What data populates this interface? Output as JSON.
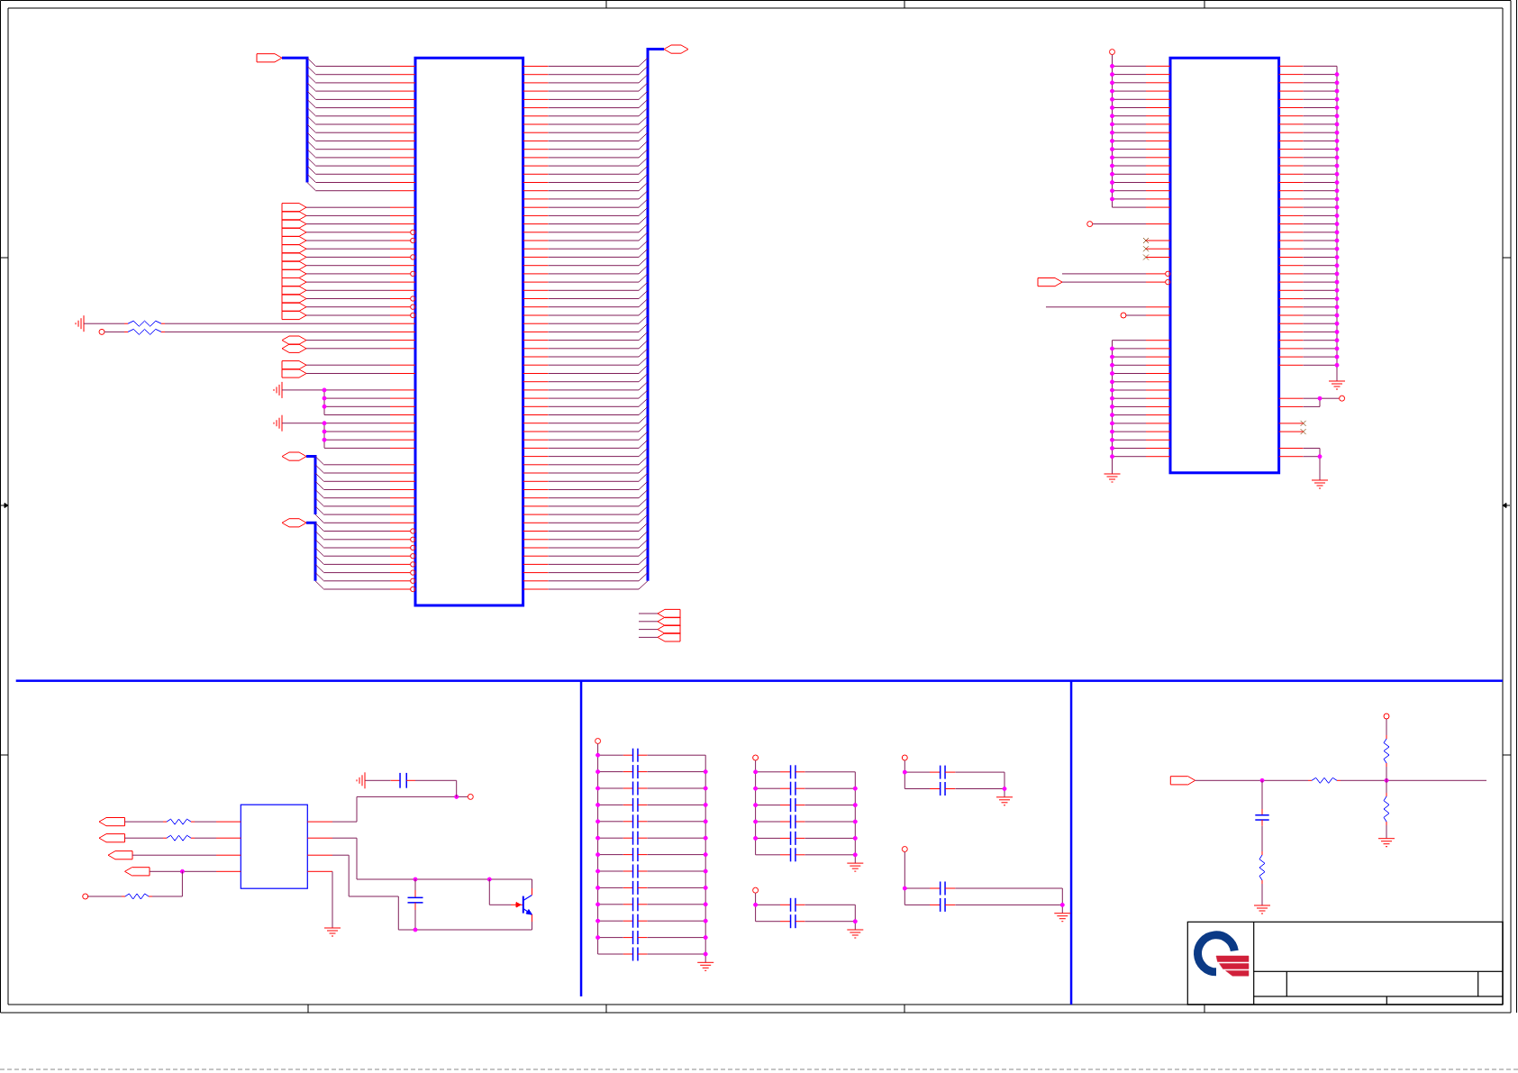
{
  "connector": {
    "left_groups": [
      {
        "kind": "bus",
        "port": {
          "kind": "output"
        },
        "pins": [
          {
            "inverted": false
          },
          {
            "inverted": false
          },
          {
            "inverted": false
          },
          {
            "inverted": false
          },
          {
            "inverted": false
          },
          {
            "inverted": false
          },
          {
            "inverted": false
          },
          {
            "inverted": false
          },
          {
            "inverted": false
          },
          {
            "inverted": false
          },
          {
            "inverted": false
          },
          {
            "inverted": false
          },
          {
            "inverted": false
          },
          {
            "inverted": false
          },
          {
            "inverted": false
          },
          {
            "inverted": false
          }
        ]
      },
      {
        "kind": "input-ports",
        "pins": [
          {
            "inverted": false
          },
          {
            "inverted": false
          },
          {
            "inverted": false
          },
          {
            "inverted": true
          },
          {
            "inverted": true
          },
          {
            "inverted": false
          },
          {
            "inverted": true
          },
          {
            "inverted": false
          },
          {
            "inverted": true
          },
          {
            "inverted": false
          },
          {
            "inverted": false
          },
          {
            "inverted": true
          },
          {
            "inverted": true
          },
          {
            "inverted": true
          }
        ]
      },
      {
        "kind": "resistor-to-ground",
        "pins": [
          {
            "inverted": false
          }
        ]
      },
      {
        "kind": "resistor-to-terminal",
        "pins": [
          {
            "inverted": false
          }
        ]
      },
      {
        "kind": "bidir-ports",
        "pins": [
          {
            "inverted": false
          },
          {
            "inverted": false
          }
        ]
      },
      {
        "kind": "input-ports",
        "pins": [
          {
            "inverted": false
          },
          {
            "inverted": false
          }
        ]
      },
      {
        "kind": "chassis-ground-tie",
        "pins": [
          {
            "inverted": false
          },
          {
            "inverted": false
          },
          {
            "inverted": false
          },
          {
            "inverted": false
          }
        ]
      },
      {
        "kind": "chassis-ground-tie",
        "pins": [
          {
            "inverted": false
          },
          {
            "inverted": false
          },
          {
            "inverted": false
          },
          {
            "inverted": false
          }
        ]
      },
      {
        "kind": "bus",
        "port": {
          "kind": "bidir"
        },
        "pins": [
          {
            "inverted": false
          },
          {
            "inverted": false
          },
          {
            "inverted": false
          },
          {
            "inverted": false
          },
          {
            "inverted": false
          },
          {
            "inverted": false
          },
          {
            "inverted": false
          },
          {
            "inverted": false
          }
        ]
      },
      {
        "kind": "bus",
        "port": {
          "kind": "bidir"
        },
        "pins": [
          {
            "inverted": true
          },
          {
            "inverted": true
          },
          {
            "inverted": true
          },
          {
            "inverted": true
          },
          {
            "inverted": true
          },
          {
            "inverted": true
          },
          {
            "inverted": true
          },
          {
            "inverted": true
          }
        ]
      }
    ],
    "right_groups": [
      {
        "kind": "bus",
        "port": {
          "kind": "bidir"
        },
        "pins": [
          {
            "inverted": false
          },
          {
            "inverted": false
          },
          {
            "inverted": false
          },
          {
            "inverted": false
          },
          {
            "inverted": false
          },
          {
            "inverted": false
          },
          {
            "inverted": false
          },
          {
            "inverted": false
          },
          {
            "inverted": false
          },
          {
            "inverted": false
          },
          {
            "inverted": false
          },
          {
            "inverted": false
          },
          {
            "inverted": false
          },
          {
            "inverted": false
          },
          {
            "inverted": false
          },
          {
            "inverted": false
          },
          {
            "inverted": false
          },
          {
            "inverted": false
          },
          {
            "inverted": false
          },
          {
            "inverted": false
          },
          {
            "inverted": false
          },
          {
            "inverted": false
          },
          {
            "inverted": false
          },
          {
            "inverted": false
          },
          {
            "inverted": false
          },
          {
            "inverted": false
          },
          {
            "inverted": false
          },
          {
            "inverted": false
          },
          {
            "inverted": false
          },
          {
            "inverted": false
          },
          {
            "inverted": false
          },
          {
            "inverted": false
          },
          {
            "inverted": false
          },
          {
            "inverted": false
          },
          {
            "inverted": false
          },
          {
            "inverted": false
          },
          {
            "inverted": false
          },
          {
            "inverted": false
          },
          {
            "inverted": false
          },
          {
            "inverted": false
          },
          {
            "inverted": false
          },
          {
            "inverted": false
          },
          {
            "inverted": false
          },
          {
            "inverted": false
          },
          {
            "inverted": false
          },
          {
            "inverted": false
          },
          {
            "inverted": false
          },
          {
            "inverted": false
          },
          {
            "inverted": false
          },
          {
            "inverted": false
          },
          {
            "inverted": false
          },
          {
            "inverted": false
          },
          {
            "inverted": false
          },
          {
            "inverted": false
          },
          {
            "inverted": false
          },
          {
            "inverted": false
          },
          {
            "inverted": false
          },
          {
            "inverted": false
          },
          {
            "inverted": false
          },
          {
            "inverted": false
          },
          {
            "inverted": false
          },
          {
            "inverted": false
          },
          {
            "inverted": false
          },
          {
            "inverted": false
          }
        ]
      }
    ],
    "spare_ports": [
      {
        "kind": "output-port"
      },
      {
        "kind": "output-port"
      },
      {
        "kind": "output-port"
      },
      {
        "kind": "output-port"
      }
    ]
  },
  "memory": {
    "left_groups": [
      {
        "kind": "supply-tie",
        "pins": [
          {
            "inverted": false
          },
          {
            "inverted": false
          },
          {
            "inverted": false
          },
          {
            "inverted": false
          },
          {
            "inverted": false
          },
          {
            "inverted": false
          },
          {
            "inverted": false
          },
          {
            "inverted": false
          },
          {
            "inverted": false
          },
          {
            "inverted": false
          },
          {
            "inverted": false
          },
          {
            "inverted": false
          },
          {
            "inverted": false
          },
          {
            "inverted": false
          },
          {
            "inverted": false
          },
          {
            "inverted": false
          },
          {
            "inverted": false
          },
          {
            "inverted": false
          }
        ]
      },
      {
        "kind": "terminal",
        "pins": [
          {
            "inverted": false
          }
        ]
      },
      {
        "kind": "no-connect",
        "pins": [
          {
            "inverted": false
          },
          {
            "inverted": false
          },
          {
            "inverted": false
          }
        ]
      },
      {
        "kind": "open-wire",
        "pins": [
          {
            "inverted": true
          }
        ]
      },
      {
        "kind": "input-ports",
        "pins": [
          {
            "inverted": true
          }
        ]
      },
      {
        "kind": "open-wire",
        "pins": [
          {
            "inverted": false
          }
        ]
      },
      {
        "kind": "terminal",
        "pins": [
          {
            "inverted": false
          }
        ]
      },
      {
        "kind": "ground-tie",
        "pins": [
          {
            "inverted": false
          },
          {
            "inverted": false
          },
          {
            "inverted": false
          },
          {
            "inverted": false
          },
          {
            "inverted": false
          },
          {
            "inverted": false
          },
          {
            "inverted": false
          },
          {
            "inverted": false
          },
          {
            "inverted": false
          },
          {
            "inverted": false
          },
          {
            "inverted": false
          },
          {
            "inverted": false
          },
          {
            "inverted": false
          },
          {
            "inverted": false
          },
          {
            "inverted": false
          }
        ]
      }
    ],
    "right_groups": [
      {
        "kind": "ground-tie",
        "pins": [
          {
            "inverted": false
          },
          {
            "inverted": false
          },
          {
            "inverted": false
          },
          {
            "inverted": false
          },
          {
            "inverted": false
          },
          {
            "inverted": false
          },
          {
            "inverted": false
          },
          {
            "inverted": false
          },
          {
            "inverted": false
          },
          {
            "inverted": false
          },
          {
            "inverted": false
          },
          {
            "inverted": false
          },
          {
            "inverted": false
          },
          {
            "inverted": false
          },
          {
            "inverted": false
          },
          {
            "inverted": false
          },
          {
            "inverted": false
          },
          {
            "inverted": false
          },
          {
            "inverted": false
          },
          {
            "inverted": false
          },
          {
            "inverted": false
          },
          {
            "inverted": false
          },
          {
            "inverted": false
          },
          {
            "inverted": false
          },
          {
            "inverted": false
          },
          {
            "inverted": false
          },
          {
            "inverted": false
          },
          {
            "inverted": false
          },
          {
            "inverted": false
          },
          {
            "inverted": false
          },
          {
            "inverted": false
          },
          {
            "inverted": false
          },
          {
            "inverted": false
          },
          {
            "inverted": false
          },
          {
            "inverted": false
          },
          {
            "inverted": false
          },
          {
            "inverted": false
          }
        ]
      },
      {
        "kind": "terminal-tie",
        "pins": [
          {
            "inverted": false
          },
          {
            "inverted": false
          }
        ]
      },
      {
        "kind": "no-connect",
        "pins": [
          {
            "inverted": false
          },
          {
            "inverted": false
          }
        ]
      },
      {
        "kind": "ground-tie",
        "pins": [
          {
            "inverted": false
          },
          {
            "inverted": false
          }
        ]
      }
    ]
  },
  "level_shifter": {
    "inputs": [
      {
        "kind": "resistor-port"
      },
      {
        "kind": "resistor-port"
      },
      {
        "kind": "port"
      },
      {
        "kind": "pulled-port"
      }
    ],
    "outputs": [
      {
        "kind": "supply"
      },
      {
        "kind": "switch-drive"
      },
      {
        "kind": "switch-return"
      },
      {
        "kind": "ground"
      }
    ]
  },
  "decoupling_banks": [
    {
      "capacitors": [
        {
          "kind": "capacitor"
        },
        {
          "kind": "capacitor"
        },
        {
          "kind": "capacitor"
        },
        {
          "kind": "capacitor"
        },
        {
          "kind": "capacitor"
        },
        {
          "kind": "capacitor"
        },
        {
          "kind": "capacitor"
        },
        {
          "kind": "capacitor"
        },
        {
          "kind": "capacitor"
        },
        {
          "kind": "capacitor"
        },
        {
          "kind": "capacitor"
        },
        {
          "kind": "capacitor"
        },
        {
          "kind": "capacitor"
        }
      ]
    },
    {
      "capacitors": [
        {
          "kind": "capacitor"
        },
        {
          "kind": "capacitor"
        },
        {
          "kind": "capacitor"
        },
        {
          "kind": "capacitor"
        },
        {
          "kind": "capacitor"
        },
        {
          "kind": "capacitor"
        }
      ]
    },
    {
      "capacitors": [
        {
          "kind": "capacitor"
        },
        {
          "kind": "capacitor"
        }
      ]
    },
    {
      "capacitors": [
        {
          "kind": "capacitor"
        },
        {
          "kind": "capacitor"
        }
      ]
    },
    {
      "capacitors": [
        {
          "kind": "capacitor"
        },
        {
          "kind": "capacitor"
        }
      ]
    }
  ],
  "filter": {
    "kind": "rc-divider"
  },
  "title_block": {
    "logo": true
  }
}
